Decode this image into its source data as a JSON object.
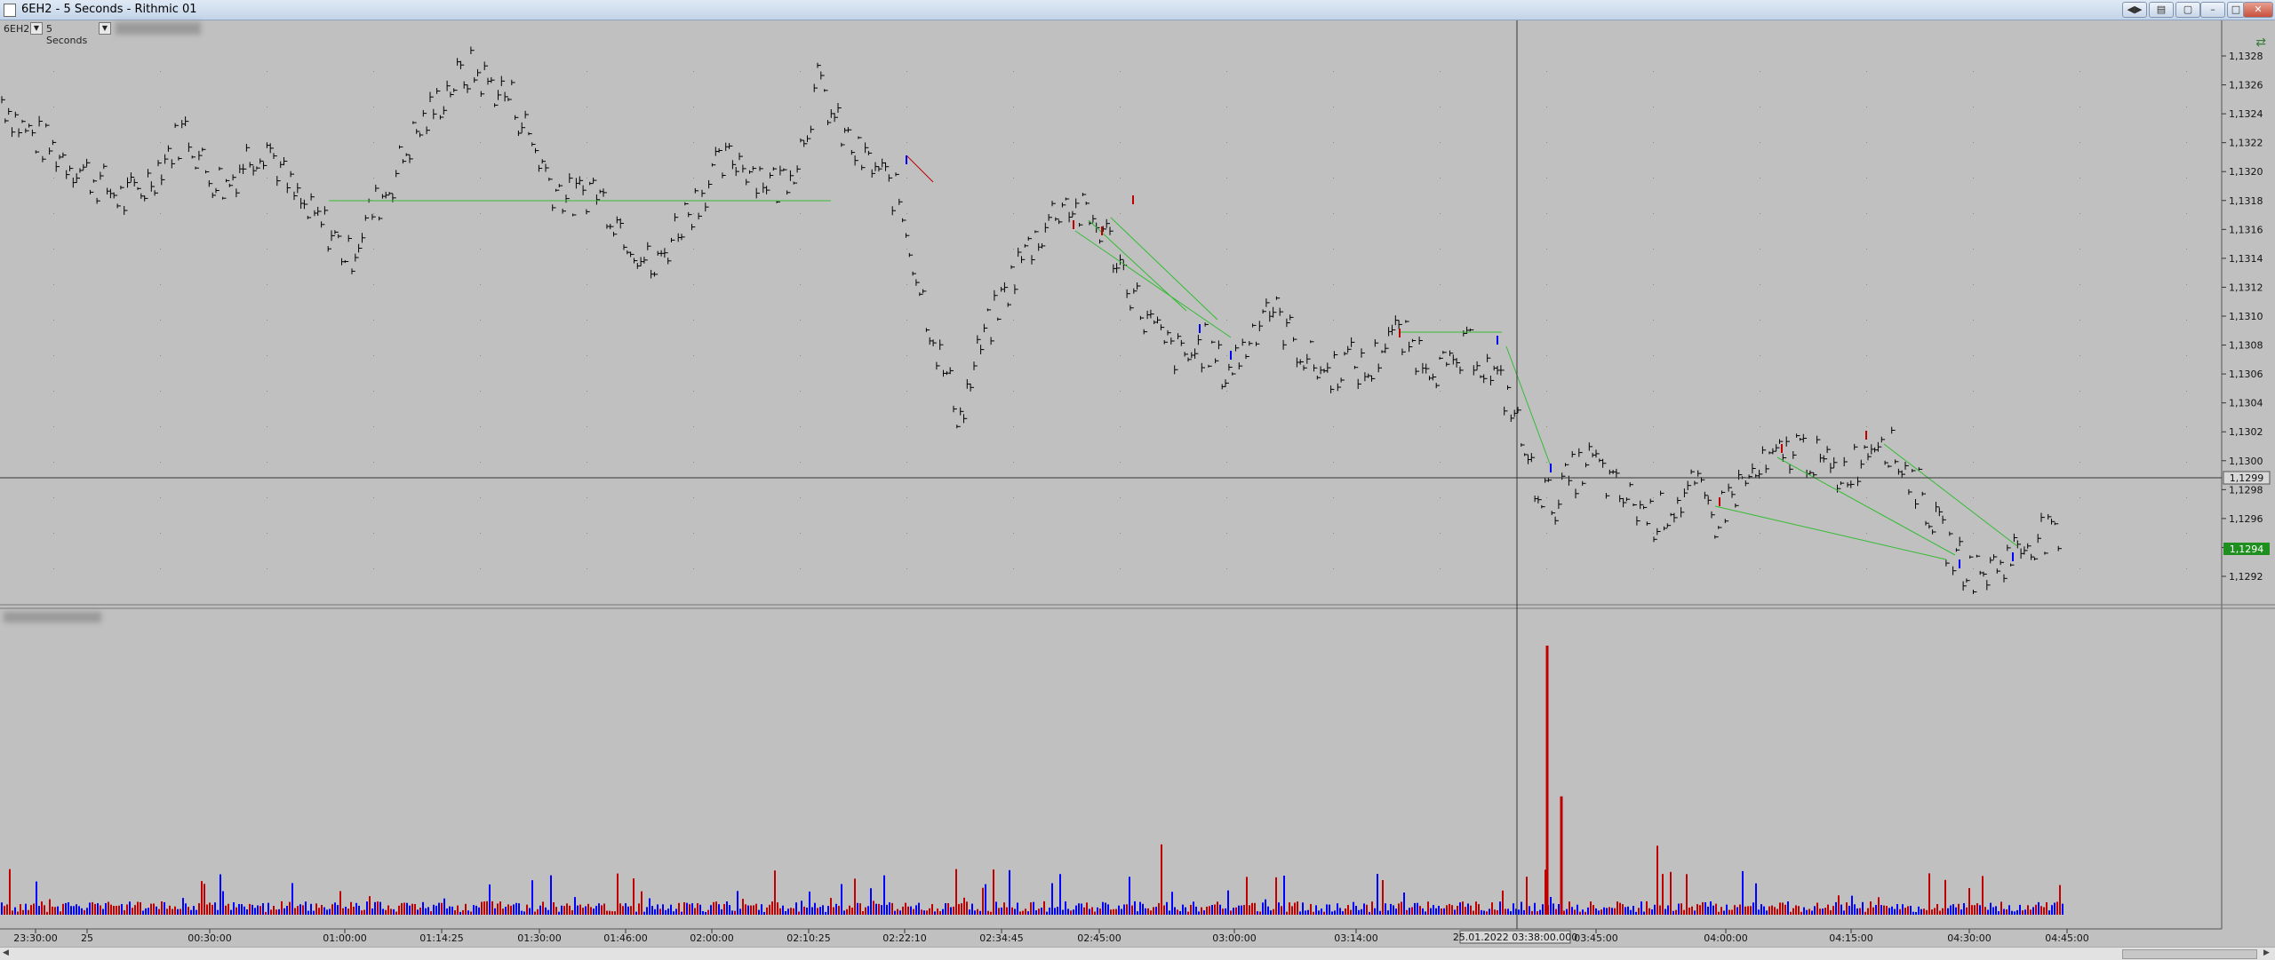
{
  "window": {
    "title": "6EH2 - 5 Seconds - Rithmic 01"
  },
  "toolbar": {
    "instrument": "6EH2",
    "interval": "5 Seconds"
  },
  "price_axis": {
    "labels": [
      "1,1328",
      "1,1326",
      "1,1324",
      "1,1322",
      "1,1320",
      "1,1318",
      "1,1316",
      "1,1314",
      "1,1312",
      "1,1310",
      "1,1308",
      "1,1306",
      "1,1304",
      "1,1302",
      "1,1300",
      "1,1298",
      "1,1296",
      "1,1294",
      "1,1292"
    ],
    "crosshair_price": "1,1299",
    "last_price": "1,1294",
    "last_price_color": "#1f8f1f"
  },
  "time_axis": {
    "labels": [
      "23:30:00",
      "25",
      "00:30:00",
      "01:00:00",
      "01:14:25",
      "01:30:00",
      "01:46:00",
      "02:00:00",
      "02:10:25",
      "02:22:10",
      "02:34:45",
      "02:45:00",
      "03:00:00",
      "03:14:00",
      "03:45:00",
      "04:00:00",
      "04:15:00",
      "04:30:00",
      "04:45:00"
    ],
    "crosshair_time": "25.01.2022 03:38:00.000"
  },
  "colors": {
    "buy": "#0000ff",
    "sell": "#c00000",
    "trendline": "#33bb33",
    "bars": "#000000"
  },
  "chart_data": {
    "type": "line",
    "title": "",
    "xlabel": "",
    "ylabel": "",
    "ylim": [
      1.1291,
      1.1329
    ],
    "series": [
      {
        "values": [
          1.1325,
          1.1323,
          1.1322,
          1.1321,
          1.132,
          1.1319,
          1.1318,
          1.1319,
          1.1321,
          1.1323,
          1.132,
          1.1319,
          1.1321,
          1.1322,
          1.1319,
          1.1317,
          1.1316,
          1.1314,
          1.1317,
          1.1319,
          1.1322,
          1.1324,
          1.1326,
          1.1327,
          1.1326,
          1.1325,
          1.1322,
          1.1319,
          1.1318,
          1.1319,
          1.1317,
          1.1315,
          1.1313,
          1.1316,
          1.1318,
          1.132,
          1.1321,
          1.132,
          1.1319,
          1.1321,
          1.1326,
          1.1323,
          1.1321,
          1.132,
          1.1318,
          1.1312,
          1.1307,
          1.1303,
          1.1308,
          1.1311,
          1.1314,
          1.1316,
          1.1318,
          1.1317,
          1.1316,
          1.1313,
          1.131,
          1.1308,
          1.1307,
          1.1308,
          1.1306,
          1.1308,
          1.1311,
          1.1309,
          1.1307,
          1.1306,
          1.1307,
          1.1306,
          1.1309,
          1.1308,
          1.1307,
          1.1306,
          1.1308,
          1.1306,
          1.1304,
          1.1299,
          1.1297,
          1.1299,
          1.13,
          1.1298,
          1.1297,
          1.1296,
          1.1297,
          1.1298,
          1.1296,
          1.1298,
          1.1299,
          1.13,
          1.1301,
          1.13,
          1.1299,
          1.13,
          1.1302,
          1.13,
          1.1298,
          1.1295,
          1.1293,
          1.1292,
          1.1293,
          1.1294,
          1.1295,
          1.1294
        ]
      }
    ],
    "volume": {
      "ylim": [
        0,
        100
      ],
      "spikes": [
        {
          "x": "03:38:00",
          "value": 100,
          "side": "sell"
        },
        {
          "x": "03:39:00",
          "value": 44,
          "side": "sell"
        }
      ]
    }
  }
}
